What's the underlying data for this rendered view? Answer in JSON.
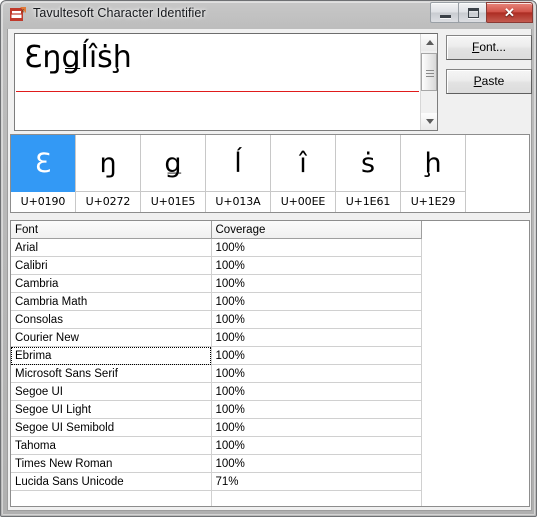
{
  "window": {
    "title": "Tavultesoft Character Identifier",
    "icon": "app-icon",
    "controls": {
      "minimize": "minimize-icon",
      "maximize": "maximize-icon",
      "close": "✕"
    }
  },
  "editor": {
    "value": "Ɛŋǥĺîṡḩ",
    "spellcheck_underline_color": "#e01b1b",
    "scrollbar": {
      "up_arrow": "scroll-up-icon",
      "down_arrow": "scroll-down-icon"
    }
  },
  "buttons": {
    "font": {
      "accel": "F",
      "rest": "ont..."
    },
    "paste": {
      "accel": "P",
      "rest": "aste"
    }
  },
  "characters": {
    "selected_index": 0,
    "selection_color": "#3399f5",
    "tiles": [
      {
        "glyph": "Ɛ",
        "code": "U+0190"
      },
      {
        "glyph": "ŋ",
        "code": "U+0272"
      },
      {
        "glyph": "ǥ",
        "code": "U+01E5"
      },
      {
        "glyph": "ĺ",
        "code": "U+013A"
      },
      {
        "glyph": "î",
        "code": "U+00EE"
      },
      {
        "glyph": "ṡ",
        "code": "U+1E61"
      },
      {
        "glyph": "ḩ",
        "code": "U+1E29"
      }
    ]
  },
  "coverage_table": {
    "columns": [
      "Font",
      "Coverage"
    ],
    "focused_row_index": 6,
    "rows": [
      [
        "Arial",
        "100%"
      ],
      [
        "Calibri",
        "100%"
      ],
      [
        "Cambria",
        "100%"
      ],
      [
        "Cambria Math",
        "100%"
      ],
      [
        "Consolas",
        "100%"
      ],
      [
        "Courier New",
        "100%"
      ],
      [
        "Ebrima",
        "100%"
      ],
      [
        "Microsoft Sans Serif",
        "100%"
      ],
      [
        "Segoe UI",
        "100%"
      ],
      [
        "Segoe UI Light",
        "100%"
      ],
      [
        "Segoe UI Semibold",
        "100%"
      ],
      [
        "Tahoma",
        "100%"
      ],
      [
        "Times New Roman",
        "100%"
      ],
      [
        "Lucida Sans Unicode",
        "71%"
      ],
      [
        "",
        ""
      ]
    ]
  }
}
